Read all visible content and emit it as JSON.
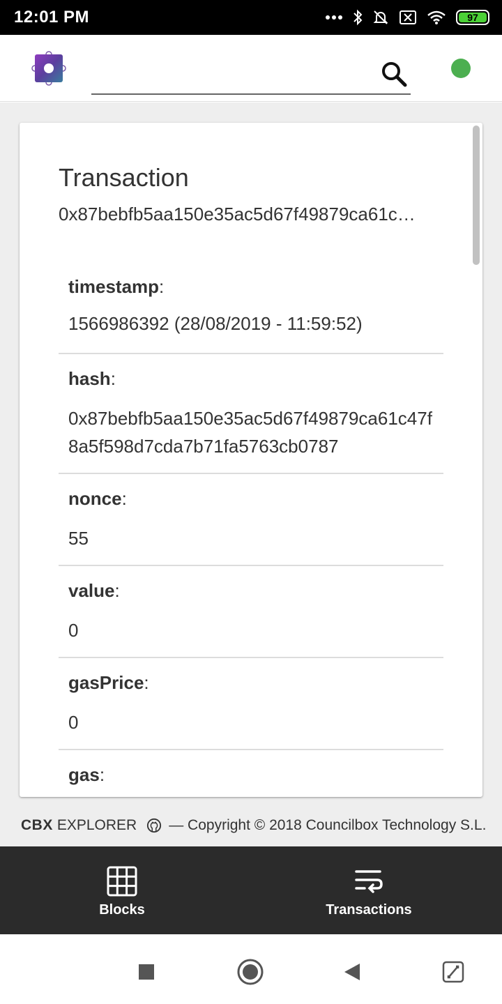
{
  "status_bar": {
    "time": "12:01 PM",
    "battery_level": "97"
  },
  "header": {
    "search_placeholder": "",
    "connection_status_color": "#4caf50"
  },
  "transaction": {
    "title": "Transaction",
    "hash_short": "0x87bebfb5aa150e35ac5d67f49879ca61c…",
    "fields": [
      {
        "label": "timestamp",
        "value": "1566986392 (28/08/2019 - 11:59:52)"
      },
      {
        "label": "hash",
        "value": "0x87bebfb5aa150e35ac5d67f49879ca61c47f8a5f598d7cda7b71fa5763cb0787"
      },
      {
        "label": "nonce",
        "value": "55"
      },
      {
        "label": "value",
        "value": "0"
      },
      {
        "label": "gasPrice",
        "value": "0"
      },
      {
        "label": "gas",
        "value": ""
      }
    ]
  },
  "footer": {
    "brand": "CBX",
    "brand_suffix": "EXPLORER",
    "copyright": "— Copyright © 2018 Councilbox Technology S.L."
  },
  "bottom_nav": {
    "blocks_label": "Blocks",
    "transactions_label": "Transactions"
  },
  "icons": {
    "logo": "councilbox-logo-icon",
    "search": "search-icon",
    "github": "github-icon",
    "blocks": "grid-icon",
    "transactions": "transactions-icon"
  }
}
